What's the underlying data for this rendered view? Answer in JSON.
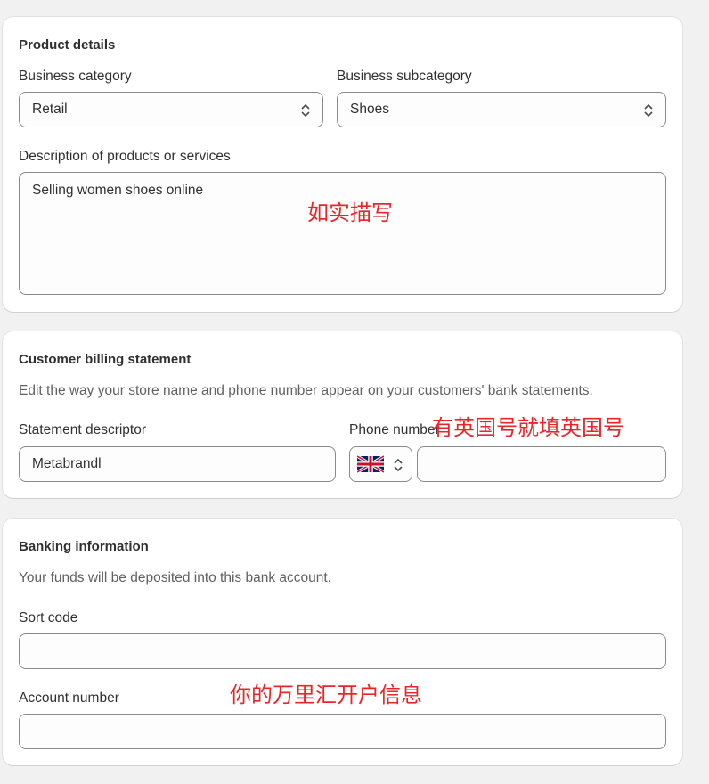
{
  "product": {
    "title": "Product details",
    "category_label": "Business category",
    "category_value": "Retail",
    "subcategory_label": "Business subcategory",
    "subcategory_value": "Shoes",
    "description_label": "Description of products or services",
    "description_value": "Selling women shoes online",
    "annotation": "如实描写"
  },
  "billing": {
    "title": "Customer billing statement",
    "help": "Edit the way your store name and phone number appear on your customers' bank statements.",
    "descriptor_label": "Statement descriptor",
    "descriptor_value": "Metabrandl",
    "phone_label": "Phone number",
    "phone_country_icon": "uk-flag-icon",
    "phone_value": "",
    "annotation": "有英国号就填英国号"
  },
  "banking": {
    "title": "Banking information",
    "help": "Your funds will be deposited into this bank account.",
    "sort_code_label": "Sort code",
    "sort_code_value": "",
    "account_number_label": "Account number",
    "account_number_value": "",
    "annotation": "你的万里汇开户信息"
  },
  "colors": {
    "annotation": "#e8262a",
    "border": "#8a8a8a",
    "page_bg": "#f1f1f1"
  }
}
